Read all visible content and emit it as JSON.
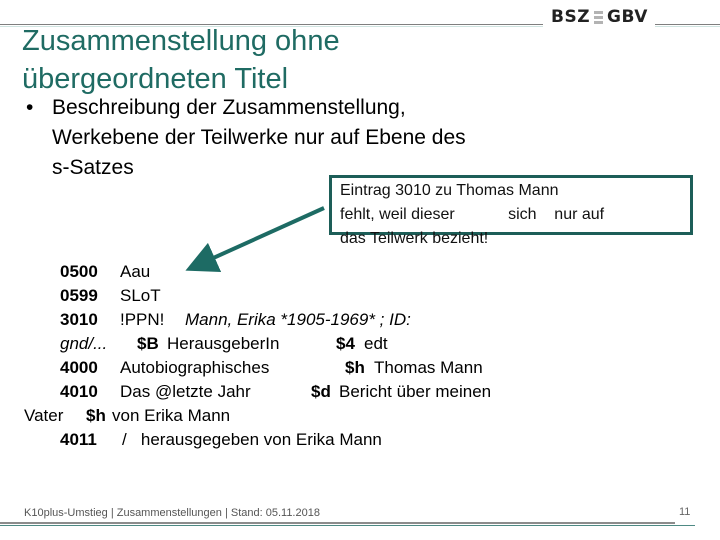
{
  "header": {
    "logo_left": "BSZ",
    "logo_right": "GBV",
    "logo_icon": "stacked-bars-icon"
  },
  "slide": {
    "title_line1": "Zusammenstellung ohne",
    "title_line2": "übergeordneten Titel",
    "bullet_symbol": "•",
    "bullet_lines": [
      "Beschreibung der Zusammenstellung,",
      "Werkebene der Teilwerke nur auf Ebene des",
      "s-Satzes"
    ]
  },
  "callout": {
    "lines": [
      "Eintrag 3010 zu Thomas Mann",
      "fehlt, weil dieser            sich    nur auf",
      "das Teilwerk bezieht!"
    ],
    "border_color": "#1d5e58",
    "arrow_color": "#1d6b64"
  },
  "record": {
    "r0500": {
      "code": "0500",
      "value": "Aau"
    },
    "r0599": {
      "code": "0599",
      "value": "SLoT"
    },
    "r3010": {
      "code": "3010",
      "ppn": "!PPN!",
      "value_italic": "Mann, Erika *1905-1969* ; ID:",
      "cont_italic": "gnd/...",
      "sub1": "$B",
      "sub1_val": "HerausgeberIn",
      "sub2": "$4",
      "sub2_val": "edt"
    },
    "r4000": {
      "code": "4000",
      "value": "Autobiographisches",
      "sub": "$h",
      "sub_val": "Thomas Mann"
    },
    "r4010": {
      "code": "4010",
      "value": "Das @letzte Jahr",
      "sub": "$d",
      "sub_val": "Bericht über meinen",
      "cont": "Vater",
      "sub2": "$h",
      "sub2_val": "von Erika Mann"
    },
    "r4011": {
      "code": "4011",
      "value": "/   herausgegeben von Erika Mann"
    }
  },
  "footer": {
    "text": "K10plus-Umstieg | Zusammenstellungen | Stand: 05.11.2018",
    "page_number": "11"
  },
  "colors": {
    "title": "#1f6b63",
    "accent": "#1d5e58"
  }
}
